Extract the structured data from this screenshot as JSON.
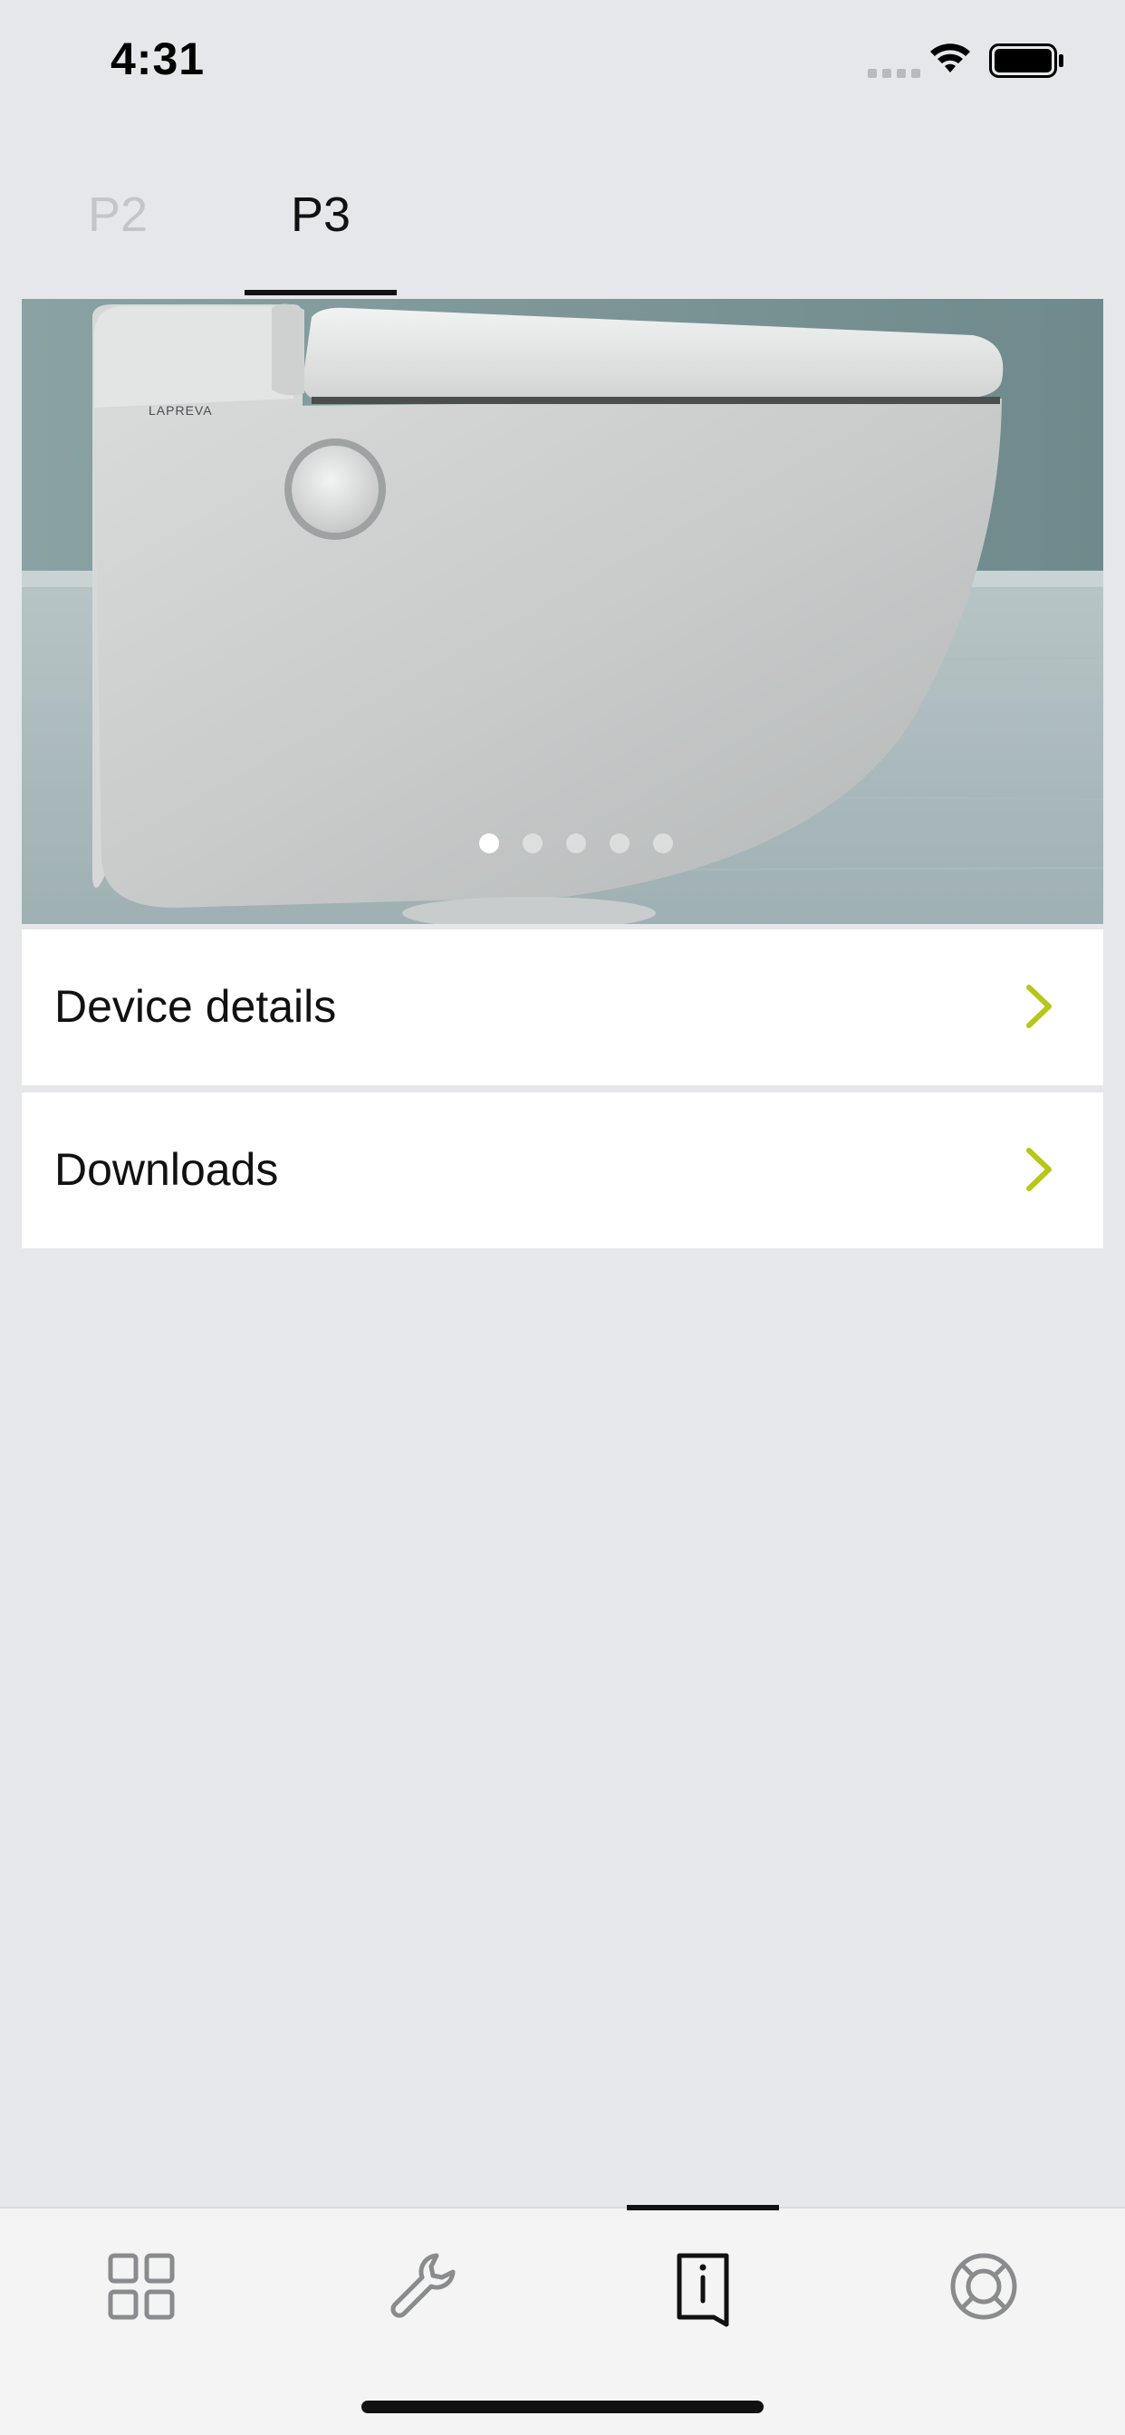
{
  "status_bar": {
    "time": "4:31"
  },
  "device_tabs": [
    {
      "label": "P2",
      "selected": false
    },
    {
      "label": "P3",
      "selected": true
    }
  ],
  "hero": {
    "brand_text": "LAPREVA",
    "carousel": {
      "page_count": 5,
      "current_page": 1
    }
  },
  "menu": {
    "device_details_label": "Device details",
    "downloads_label": "Downloads"
  },
  "tab_bar": {
    "items": [
      {
        "icon": "grid-icon",
        "selected": false
      },
      {
        "icon": "wrench-icon",
        "selected": false
      },
      {
        "icon": "info-book-icon",
        "selected": true
      },
      {
        "icon": "lifebuoy-icon",
        "selected": false
      }
    ]
  },
  "colors": {
    "background": "#e6e7eb",
    "accent_chevron": "#b7c617",
    "tab_icon": "#8a8b8f",
    "active": "#111111"
  }
}
